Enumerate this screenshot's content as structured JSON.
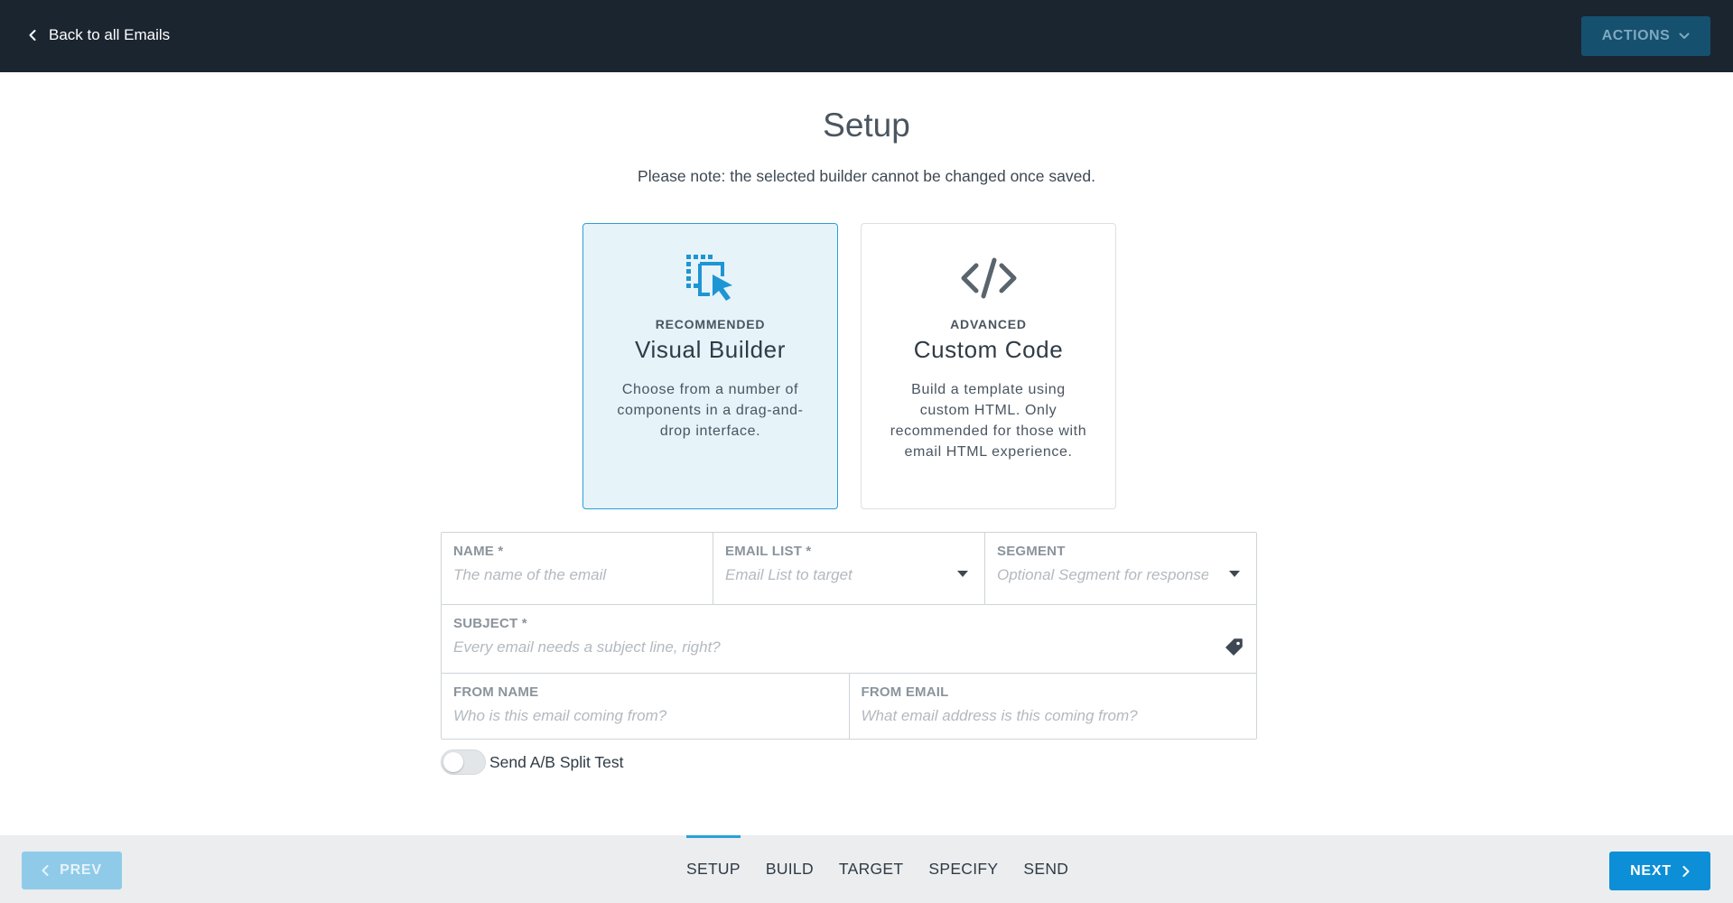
{
  "topbar": {
    "back_label": "Back to all Emails",
    "actions_label": "ACTIONS"
  },
  "page": {
    "title": "Setup",
    "note": "Please note: the selected builder cannot be changed once saved."
  },
  "builders": {
    "visual": {
      "tag": "RECOMMENDED",
      "title": "Visual Builder",
      "description": "Choose from a number of components in a drag-and-drop interface.",
      "selected": true,
      "icon": "drag-drop-icon"
    },
    "code": {
      "tag": "ADVANCED",
      "title": "Custom Code",
      "description": "Build a template using custom HTML. Only recommended for those with email HTML experience.",
      "selected": false,
      "icon": "code-icon"
    }
  },
  "form": {
    "name": {
      "label": "NAME *",
      "placeholder": "The name of the email",
      "value": ""
    },
    "email_list": {
      "label": "EMAIL LIST *",
      "placeholder": "Email List to target",
      "value": ""
    },
    "segment": {
      "label": "SEGMENT",
      "placeholder": "Optional Segment for responses",
      "value": ""
    },
    "subject": {
      "label": "SUBJECT *",
      "placeholder": "Every email needs a subject line, right?",
      "value": ""
    },
    "from_name": {
      "label": "FROM NAME",
      "placeholder": "Who is this email coming from?",
      "value": ""
    },
    "from_email": {
      "label": "FROM EMAIL",
      "placeholder": "What email address is this coming from?",
      "value": ""
    }
  },
  "ab_test": {
    "label": "Send A/B Split Test",
    "enabled": false
  },
  "footer": {
    "prev_label": "PREV",
    "next_label": "NEXT",
    "steps": [
      "SETUP",
      "BUILD",
      "TARGET",
      "SPECIFY",
      "SEND"
    ],
    "active_step": "SETUP"
  },
  "colors": {
    "topbar": "#1b2530",
    "accent": "#0c8fd6",
    "selected_card_bg": "#e6f3f9",
    "selected_card_border": "#2b9fd9"
  }
}
